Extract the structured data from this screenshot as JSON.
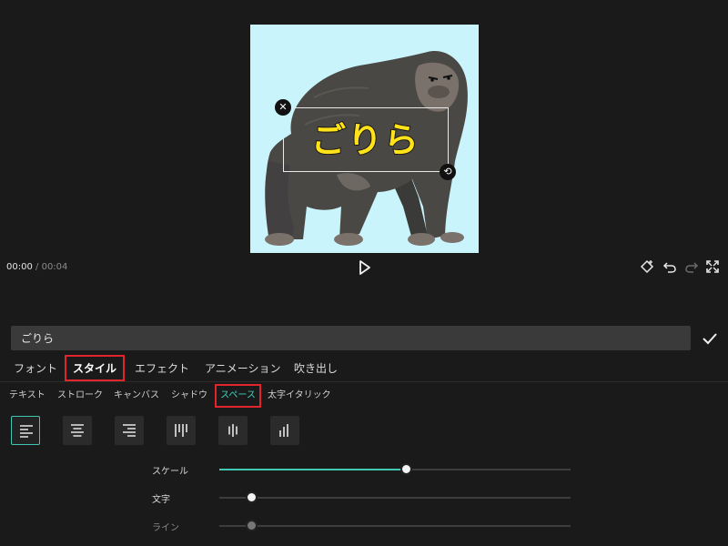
{
  "preview": {
    "overlay_text": "ごりら",
    "timecode": {
      "current": "00:00",
      "separator": "/",
      "total": "00:04"
    },
    "icons": {
      "delete": "close-icon",
      "rotate": "rotate-icon",
      "play": "play-icon",
      "keyframe": "keyframe-diamond-icon",
      "undo": "undo-icon",
      "redo": "redo-icon",
      "fullscreen": "fullscreen-icon"
    },
    "background_color": "#c9f4fb"
  },
  "editor": {
    "text_input_value": "ごりら",
    "confirm_icon": "checkmark-icon",
    "main_tabs": [
      {
        "label": "フォント",
        "active": false
      },
      {
        "label": "スタイル",
        "active": true
      },
      {
        "label": "エフェクト",
        "active": false
      },
      {
        "label": "アニメーション",
        "active": false
      },
      {
        "label": "吹き出し",
        "active": false
      }
    ],
    "sub_tabs": [
      {
        "label": "テキスト",
        "active": false
      },
      {
        "label": "ストローク",
        "active": false
      },
      {
        "label": "キャンバス",
        "active": false
      },
      {
        "label": "シャドウ",
        "active": false
      },
      {
        "label": "スペース",
        "active": true
      },
      {
        "label": "太字イタリック",
        "active": false
      }
    ],
    "alignment_options": [
      "align-left-icon",
      "align-center-icon",
      "align-right-icon",
      "vertical-align-top-icon",
      "vertical-align-middle-icon",
      "vertical-align-bottom-icon"
    ],
    "selected_alignment": "align-left-icon",
    "sliders": [
      {
        "label": "スケール",
        "value_fraction": 0.53
      },
      {
        "label": "文字",
        "value_fraction": 0.09
      },
      {
        "label": "ライン",
        "value_fraction": 0.09,
        "disabled": true
      }
    ]
  },
  "colors": {
    "accent": "#3fc7b1",
    "highlight_box": "#e0252d",
    "panel_bg": "#1a1a1a",
    "text_yellow": "#ffe21a"
  }
}
